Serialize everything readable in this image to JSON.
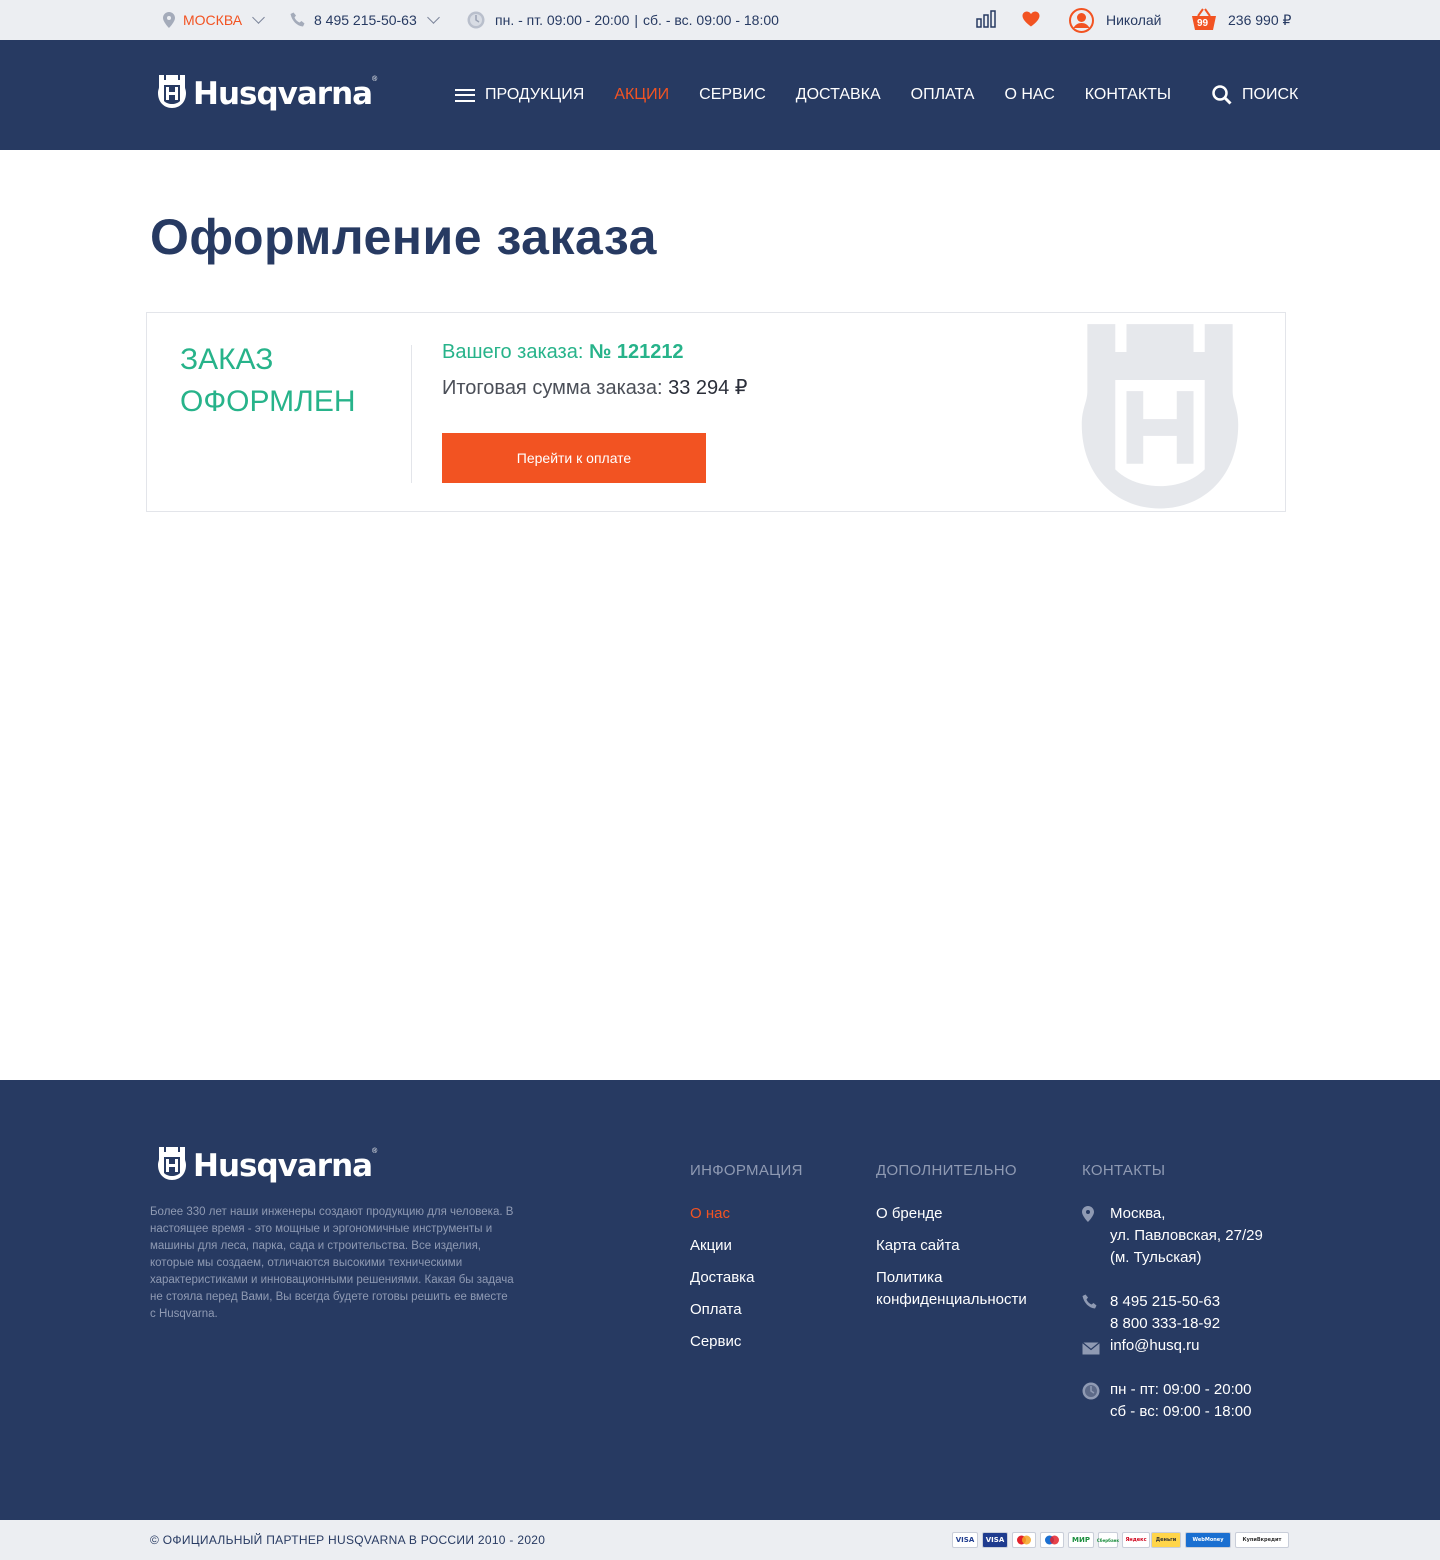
{
  "topbar": {
    "city": "МОСКВА",
    "phone": "8 495 215-50-63",
    "hours_weekdays": "пн. - пт. 09:00 - 20:00",
    "hours_separator": "|",
    "hours_weekend": "сб. - вс. 09:00 - 18:00",
    "user_name": "Николай",
    "cart_count": "99",
    "cart_total": "236 990 ₽"
  },
  "header": {
    "logo_text": "Husqvarna",
    "nav": [
      {
        "label": "ПРОДУКЦИЯ"
      },
      {
        "label": "АКЦИИ"
      },
      {
        "label": "СЕРВИС"
      },
      {
        "label": "ДОСТАВКА"
      },
      {
        "label": "ОПЛАТА"
      },
      {
        "label": "О НАС"
      },
      {
        "label": "КОНТАКТЫ"
      }
    ],
    "search_label": "ПОИСК"
  },
  "main": {
    "title": "Оформление заказа",
    "status_line1": "ЗАКАЗ",
    "status_line2": "ОФОРМЛЕН",
    "order_label": "Вашего заказа:",
    "order_number": "№ 121212",
    "sum_label": "Итоговая сумма заказа:",
    "sum_value": "33 294 ₽",
    "pay_button": "Перейти к оплате"
  },
  "footer": {
    "logo_text": "Husqvarna",
    "description": "Более 330 лет наши инженеры создают продукцию для человека. В настоящее время - это мощные и эргономичные инструменты и машины для леса, парка, сада и строительства. Все изделия, которые мы создаем, отличаются высокими техническими характеристиками и инновационными решениями. Какая бы задача не стояла перед Вами, Вы всегда будете готовы решить ее вместе с Husqvarna.",
    "info_title": "ИНФОРМАЦИЯ",
    "info_links": [
      "О нас",
      "Акции",
      "Доставка",
      "Оплата",
      "Сервис"
    ],
    "extra_title": "ДОПОЛНИТЕЛЬНО",
    "extra_links": [
      "О бренде",
      "Карта сайта",
      "Политика конфиденциальности"
    ],
    "contacts_title": "КОНТАКТЫ",
    "address_line1": "Москва,",
    "address_line2": "ул. Павловская, 27/29",
    "address_line3": "(м. Тульская)",
    "phone1": "8 495 215-50-63",
    "phone2": "8 800 333-18-92",
    "email": "info@husq.ru",
    "hours1": "пн - пт: 09:00 - 20:00",
    "hours2": "сб - вс: 09:00 - 18:00"
  },
  "bottombar": {
    "copyright": "© ОФИЦИАЛЬНЫЙ ПАРТНЕР HUSQVARNA В РОССИИ 2010 - 2020",
    "payments": [
      "VISA",
      "VISA",
      "MasterCard",
      "Maestro",
      "МИР",
      "Сбербанк",
      "Яндекс",
      "Деньги",
      "WebMoney",
      "КупиВкредит"
    ]
  },
  "colors": {
    "navy": "#273a62",
    "accent_orange": "#f25322",
    "success_green": "#27b38a",
    "topbar_gray": "#eceef2"
  }
}
